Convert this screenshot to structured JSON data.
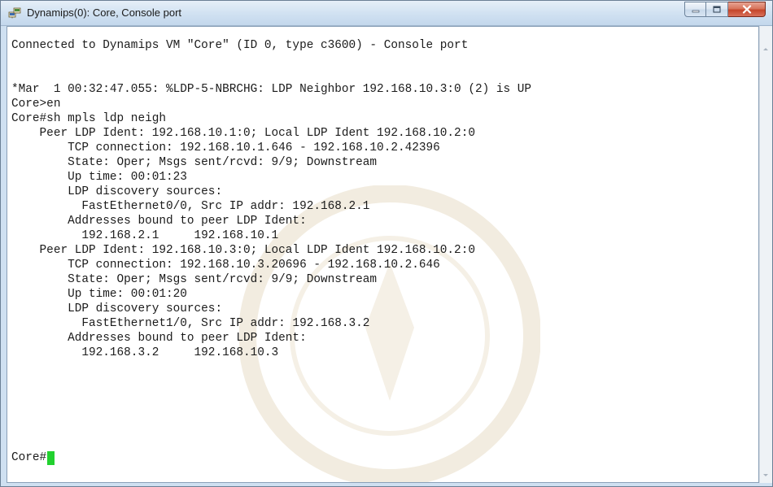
{
  "window": {
    "title": "Dynamips(0): Core, Console port",
    "controls": {
      "minimize": "minimize",
      "maximize": "maximize",
      "close": "close"
    }
  },
  "console": {
    "lines": [
      "Connected to Dynamips VM \"Core\" (ID 0, type c3600) - Console port",
      "",
      "",
      "*Mar  1 00:32:47.055: %LDP-5-NBRCHG: LDP Neighbor 192.168.10.3:0 (2) is UP",
      "Core>en",
      "Core#sh mpls ldp neigh",
      "    Peer LDP Ident: 192.168.10.1:0; Local LDP Ident 192.168.10.2:0",
      "        TCP connection: 192.168.10.1.646 - 192.168.10.2.42396",
      "        State: Oper; Msgs sent/rcvd: 9/9; Downstream",
      "        Up time: 00:01:23",
      "        LDP discovery sources:",
      "          FastEthernet0/0, Src IP addr: 192.168.2.1",
      "        Addresses bound to peer LDP Ident:",
      "          192.168.2.1     192.168.10.1",
      "    Peer LDP Ident: 192.168.10.3:0; Local LDP Ident 192.168.10.2:0",
      "        TCP connection: 192.168.10.3.20696 - 192.168.10.2.646",
      "        State: Oper; Msgs sent/rcvd: 9/9; Downstream",
      "        Up time: 00:01:20",
      "        LDP discovery sources:",
      "          FastEthernet1/0, Src IP addr: 192.168.3.2",
      "        Addresses bound to peer LDP Ident:",
      "          192.168.3.2     192.168.10.3"
    ],
    "prompt": "Core#"
  },
  "colors": {
    "cursor": "#22d12f",
    "terminal_bg": "#ffffff",
    "text": "#1b1b1b"
  },
  "icons": {
    "app": "network-computer-icon",
    "minimize": "minimize-icon",
    "maximize": "maximize-icon",
    "close": "close-icon"
  }
}
